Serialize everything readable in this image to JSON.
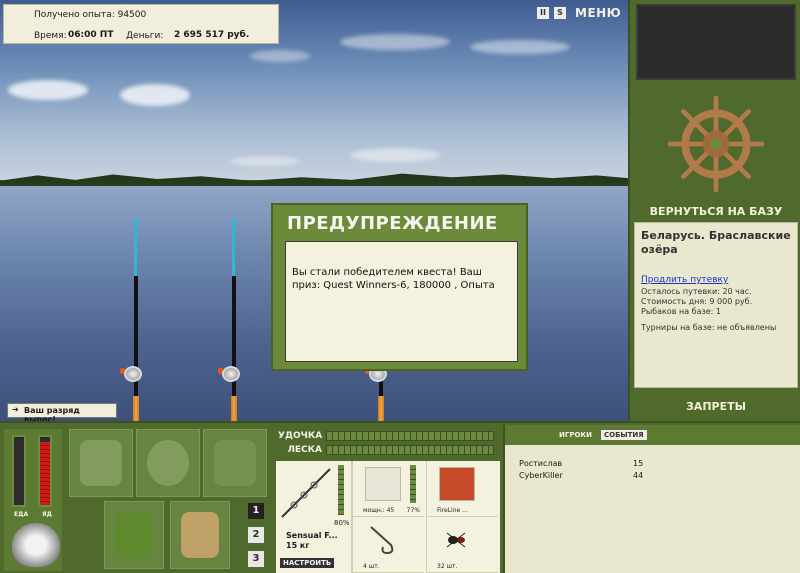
{
  "top_info": {
    "exp_label": "Получено опыта: 94500",
    "time_label": "Время:",
    "time_value": "06:00 ПТ",
    "money_label": "Деньги:",
    "money_value": "2 695 517 руб."
  },
  "top_icons": {
    "pause": "II",
    "sound": "S",
    "menu": "МЕНЮ"
  },
  "right_panel": {
    "back_button": "ВЕРНУТЬСЯ НА БАЗУ",
    "location_title": "Беларусь. Браславские озёра",
    "extend_link": "Продлить путевку",
    "lines": [
      "Осталось путевки: 20 час.",
      "Стоимость дня: 9 000 руб.",
      "Рыбаков на базе: 1"
    ],
    "tournaments": "Турниры на базе: не объявлены",
    "bans_button": "ЗАПРЕТЫ"
  },
  "dialog": {
    "title": "ПРЕДУПРЕЖДЕНИЕ",
    "message": "Вы стали победителем квеста! Ваш приз: Quest Winners-6, 180000 , Опыта"
  },
  "toast": "Ваш разряд вырос!",
  "meters": {
    "food_label": "ЕДА",
    "poison_label": "ЯД",
    "food_level": 0.0,
    "poison_level": 0.93
  },
  "pages": [
    "1",
    "2",
    "3"
  ],
  "gear": {
    "rod_label": "УДОЧКА",
    "line_label": "ЛЕСКА",
    "rod_name": "Sensual F...",
    "rod_weight": "15 кг",
    "rod_percent": "80%",
    "setup_button": "НАСТРОИТЬ",
    "reel_caption": "мощн.: 45",
    "reel_percent": "77%",
    "line_caption": "FireLine ...",
    "hook_caption": "4 шт.",
    "bait_caption": "32 шт."
  },
  "players": {
    "tabs": [
      "ИГРОКИ",
      "СОБЫТИЯ"
    ],
    "rows": [
      {
        "name": "Ростислав",
        "value": "15"
      },
      {
        "name": "CyberKiller",
        "value": "44"
      }
    ]
  },
  "colors": {
    "panel": "#4f6a2c",
    "paper": "#f4f2de",
    "accent_red": "#d11b12",
    "link": "#1a33c9"
  }
}
